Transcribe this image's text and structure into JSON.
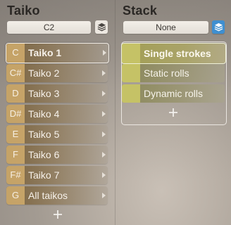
{
  "taiko": {
    "title": "Taiko",
    "selector_value": "C2",
    "items": [
      {
        "note": "C",
        "label": "Taiko 1"
      },
      {
        "note": "C#",
        "label": "Taiko 2"
      },
      {
        "note": "D",
        "label": "Taiko 3"
      },
      {
        "note": "D#",
        "label": "Taiko 4"
      },
      {
        "note": "E",
        "label": "Taiko 5"
      },
      {
        "note": "F",
        "label": "Taiko 6"
      },
      {
        "note": "F#",
        "label": "Taiko 7"
      },
      {
        "note": "G",
        "label": "All taikos"
      }
    ],
    "selected_index": 0
  },
  "stack": {
    "title": "Stack",
    "selector_value": "None",
    "items": [
      {
        "label": "Single strokes"
      },
      {
        "label": "Static rolls"
      },
      {
        "label": "Dynamic rolls"
      }
    ],
    "selected_index": 0
  },
  "icons": {
    "taiko_layers": "layers-icon",
    "stack_layers": "layers-icon",
    "add": "plus-icon",
    "submenu": "chevron-right-icon"
  },
  "colors": {
    "taiko_note_accent": "#cdaa6c",
    "stack_swatch": "#c5c266",
    "stack_layers_active": "#3f8fd0"
  }
}
